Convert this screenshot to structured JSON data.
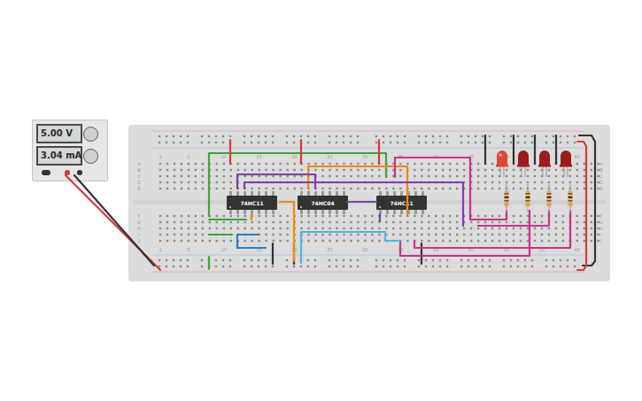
{
  "power_supply": {
    "voltage": "5.00 V",
    "current": "3.04 mA",
    "on": true
  },
  "breadboard": {
    "column_labels": [
      "1",
      "5",
      "10",
      "15",
      "20",
      "25",
      "30",
      "35",
      "40",
      "45",
      "50",
      "55",
      "60"
    ],
    "row_labels_top": [
      "A",
      "B",
      "C",
      "D",
      "E"
    ],
    "row_labels_bottom": [
      "F",
      "G",
      "H",
      "I",
      "J"
    ]
  },
  "chips": [
    {
      "label": "74HC11"
    },
    {
      "label": "74HC04"
    },
    {
      "label": "74HC11"
    }
  ],
  "leds": [
    {
      "on": true,
      "color": "#e0453a"
    },
    {
      "on": false,
      "color": "#9c1c1c"
    },
    {
      "on": false,
      "color": "#9c1c1c"
    },
    {
      "on": false,
      "color": "#9c1c1c"
    }
  ]
}
